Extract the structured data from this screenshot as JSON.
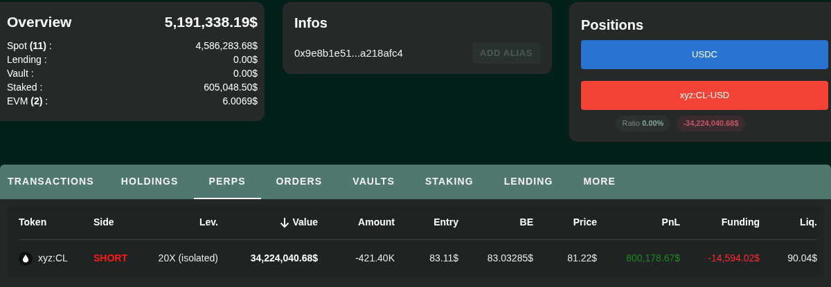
{
  "overview": {
    "title": "Overview",
    "total": "5,191,338.19$",
    "rows": [
      {
        "label": "Spot **(11)** :",
        "value": "4,586,283.68$"
      },
      {
        "label": "Lending :",
        "value": "0.00$"
      },
      {
        "label": "Vault :",
        "value": "0.00$"
      },
      {
        "label": "Staked :",
        "value": "605,048.50$"
      },
      {
        "label": "EVM **(2)** :",
        "value": "6.0069$"
      }
    ]
  },
  "infos": {
    "title": "Infos",
    "address": "0x9e8b1e51...a218afc4",
    "button": {
      "label": "ADD ALIAS",
      "disabled": true
    }
  },
  "positions": {
    "title": "Positions",
    "bars": [
      {
        "label": "USDC",
        "color": "#2874d0"
      },
      {
        "label": "xyz:CL-USD",
        "color": "#f44336"
      }
    ],
    "ratio": {
      "label": "Ratio",
      "value": "0.00%"
    },
    "net": "-34,224,040.68$"
  },
  "tabs": [
    {
      "label": "TRANSACTIONS",
      "selected": false
    },
    {
      "label": "HOLDINGS",
      "selected": false
    },
    {
      "label": "PERPS",
      "selected": true
    },
    {
      "label": "ORDERS",
      "selected": false
    },
    {
      "label": "VAULTS",
      "selected": false
    },
    {
      "label": "STAKING",
      "selected": false
    },
    {
      "label": "LENDING",
      "selected": false
    },
    {
      "label": "MORE",
      "selected": false
    }
  ],
  "table": {
    "columns": [
      {
        "label": "Token",
        "sorted": false
      },
      {
        "label": "Side",
        "sorted": false
      },
      {
        "label": "Lev.",
        "sorted": false
      },
      {
        "label": "Value",
        "sorted": true
      },
      {
        "label": "Amount",
        "sorted": false
      },
      {
        "label": "Entry",
        "sorted": false
      },
      {
        "label": "BE",
        "sorted": false
      },
      {
        "label": "Price",
        "sorted": false
      },
      {
        "label": "PnL",
        "sorted": false
      },
      {
        "label": "Funding",
        "sorted": false
      },
      {
        "label": "Liq.",
        "sorted": false
      }
    ],
    "rows": [
      {
        "cells": [
          {
            "text": "xyz:CL",
            "kind": "token"
          },
          {
            "text": "SHORT",
            "kind": "short"
          },
          {
            "text": "20X (isolated)",
            "kind": "plain"
          },
          {
            "text": "34,224,040.68$",
            "kind": "bold"
          },
          {
            "text": "-421.40K",
            "kind": "plain"
          },
          {
            "text": "83.11$",
            "kind": "plain"
          },
          {
            "text": "83.03285$",
            "kind": "plain"
          },
          {
            "text": "81.22$",
            "kind": "plain"
          },
          {
            "text": "800,178.67$",
            "kind": "positive"
          },
          {
            "text": "-14,594.02$",
            "kind": "negative"
          },
          {
            "text": "90.04$",
            "kind": "plain"
          }
        ]
      }
    ]
  }
}
